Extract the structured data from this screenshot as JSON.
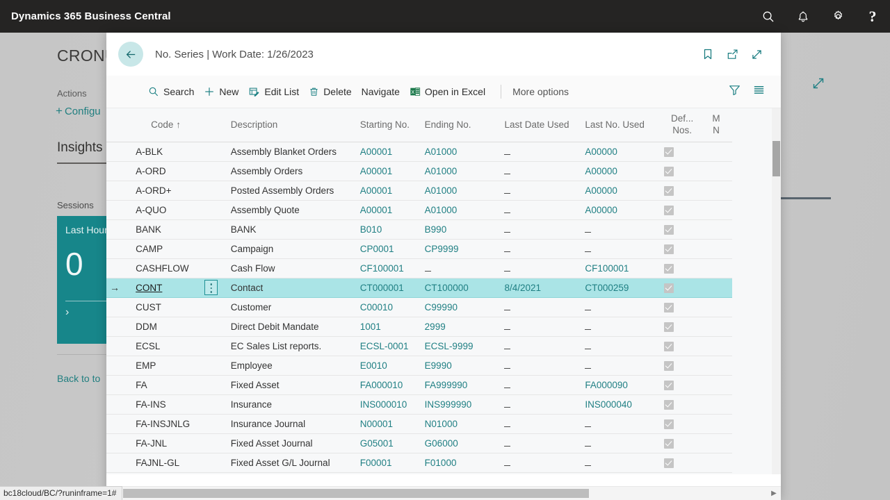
{
  "topbar": {
    "title": "Dynamics 365 Business Central",
    "icons": [
      {
        "name": "search-icon",
        "label": "Search"
      },
      {
        "name": "notifications-bell-icon",
        "label": "Notifications"
      },
      {
        "name": "settings-gear-icon",
        "label": "Settings"
      },
      {
        "name": "help-question-icon",
        "label": "?"
      }
    ]
  },
  "background": {
    "company": "CRONU",
    "actions_label": "Actions",
    "configure_label": "Configu",
    "configure_plus": "+",
    "insights_label": "Insights",
    "sessions_label": "Sessions",
    "tile": {
      "title": "Last Hour",
      "value": "0",
      "chevron": "›"
    },
    "back_to_top": "Back to to"
  },
  "modal": {
    "back_button_label": "Back",
    "title": "No. Series | Work Date: 1/26/2023",
    "header_icons": [
      {
        "name": "bookmark-icon",
        "label": "Bookmark"
      },
      {
        "name": "open-in-new-window-icon",
        "label": "Open in new window"
      },
      {
        "name": "expand-icon",
        "label": "Expand"
      }
    ]
  },
  "commandbar": {
    "search_label": "Search",
    "new_label": "New",
    "edit_list_label": "Edit List",
    "delete_label": "Delete",
    "navigate_label": "Navigate",
    "open_in_excel_label": "Open in Excel",
    "more_options_label": "More options",
    "filter_icon_label": "Filter",
    "list_view_icon_label": "Focus mode"
  },
  "table": {
    "columns": [
      {
        "key": "code",
        "label": "Code",
        "sort": "↑"
      },
      {
        "key": "description",
        "label": "Description"
      },
      {
        "key": "starting_no",
        "label": "Starting No."
      },
      {
        "key": "ending_no",
        "label": "Ending No."
      },
      {
        "key": "last_date_used",
        "label": "Last Date Used"
      },
      {
        "key": "last_no_used",
        "label": "Last No. Used"
      },
      {
        "key": "default_nos",
        "label_line1": "Def...",
        "label_line2": "Nos."
      },
      {
        "key": "manual_nos",
        "label_line1": "M",
        "label_line2": "N"
      }
    ],
    "empty_marker": "_",
    "rows": [
      {
        "code": "A-BLK",
        "description": "Assembly Blanket Orders",
        "starting_no": "A00001",
        "ending_no": "A01000",
        "last_date_used": "_",
        "last_no_used": "A00000",
        "default_nos": true,
        "selected": false
      },
      {
        "code": "A-ORD",
        "description": "Assembly Orders",
        "starting_no": "A00001",
        "ending_no": "A01000",
        "last_date_used": "_",
        "last_no_used": "A00000",
        "default_nos": true,
        "selected": false
      },
      {
        "code": "A-ORD+",
        "description": "Posted Assembly Orders",
        "starting_no": "A00001",
        "ending_no": "A01000",
        "last_date_used": "_",
        "last_no_used": "A00000",
        "default_nos": true,
        "selected": false
      },
      {
        "code": "A-QUO",
        "description": "Assembly Quote",
        "starting_no": "A00001",
        "ending_no": "A01000",
        "last_date_used": "_",
        "last_no_used": "A00000",
        "default_nos": true,
        "selected": false
      },
      {
        "code": "BANK",
        "description": "BANK",
        "starting_no": "B010",
        "ending_no": "B990",
        "last_date_used": "_",
        "last_no_used": "_",
        "default_nos": true,
        "selected": false
      },
      {
        "code": "CAMP",
        "description": "Campaign",
        "starting_no": "CP0001",
        "ending_no": "CP9999",
        "last_date_used": "_",
        "last_no_used": "_",
        "default_nos": true,
        "selected": false
      },
      {
        "code": "CASHFLOW",
        "description": "Cash Flow",
        "starting_no": "CF100001",
        "ending_no": "_",
        "last_date_used": "_",
        "last_no_used": "CF100001",
        "default_nos": true,
        "selected": false
      },
      {
        "code": "CONT",
        "description": "Contact",
        "starting_no": "CT000001",
        "ending_no": "CT100000",
        "last_date_used": "8/4/2021",
        "last_no_used": "CT000259",
        "default_nos": true,
        "selected": true
      },
      {
        "code": "CUST",
        "description": "Customer",
        "starting_no": "C00010",
        "ending_no": "C99990",
        "last_date_used": "_",
        "last_no_used": "_",
        "default_nos": true,
        "selected": false
      },
      {
        "code": "DDM",
        "description": "Direct Debit Mandate",
        "starting_no": "1001",
        "ending_no": "2999",
        "last_date_used": "_",
        "last_no_used": "_",
        "default_nos": true,
        "selected": false
      },
      {
        "code": "ECSL",
        "description": "EC Sales List reports.",
        "starting_no": "ECSL-0001",
        "ending_no": "ECSL-9999",
        "last_date_used": "_",
        "last_no_used": "_",
        "default_nos": true,
        "selected": false
      },
      {
        "code": "EMP",
        "description": "Employee",
        "starting_no": "E0010",
        "ending_no": "E9990",
        "last_date_used": "_",
        "last_no_used": "_",
        "default_nos": true,
        "selected": false
      },
      {
        "code": "FA",
        "description": "Fixed Asset",
        "starting_no": "FA000010",
        "ending_no": "FA999990",
        "last_date_used": "_",
        "last_no_used": "FA000090",
        "default_nos": true,
        "selected": false
      },
      {
        "code": "FA-INS",
        "description": "Insurance",
        "starting_no": "INS000010",
        "ending_no": "INS999990",
        "last_date_used": "_",
        "last_no_used": "INS000040",
        "default_nos": true,
        "selected": false
      },
      {
        "code": "FA-INSJNLG",
        "description": "Insurance Journal",
        "starting_no": "N00001",
        "ending_no": "N01000",
        "last_date_used": "_",
        "last_no_used": "_",
        "default_nos": true,
        "selected": false
      },
      {
        "code": "FA-JNL",
        "description": "Fixed Asset Journal",
        "starting_no": "G05001",
        "ending_no": "G06000",
        "last_date_used": "_",
        "last_no_used": "_",
        "default_nos": true,
        "selected": false
      },
      {
        "code": "FAJNL-GL",
        "description": "Fixed Asset G/L Journal",
        "starting_no": "F00001",
        "ending_no": "F01000",
        "last_date_used": "_",
        "last_no_used": "_",
        "default_nos": true,
        "selected": false
      }
    ],
    "row_selection_arrow": "→"
  },
  "statusbar": {
    "url": "bc18cloud/BC/?runinframe=1#"
  },
  "colors": {
    "accent_teal": "#1a7f82",
    "selection_teal": "#aae4e6",
    "topbar_dark": "#252423",
    "tile_teal": "#17868a",
    "link_teal": "#1f7f83"
  }
}
